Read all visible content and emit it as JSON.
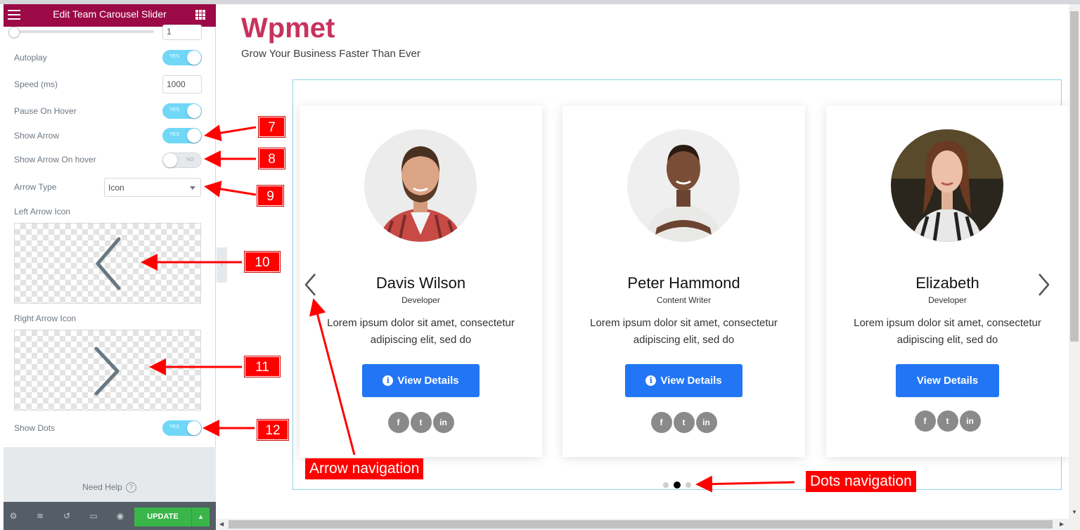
{
  "panel": {
    "title": "Edit Team Carousel Slider",
    "slides_value": "1",
    "controls": {
      "autoplay": {
        "label": "Autoplay",
        "state": "YES"
      },
      "speed": {
        "label": "Speed (ms)",
        "value": "1000"
      },
      "pause_on_hover": {
        "label": "Pause On Hover",
        "state": "YES"
      },
      "show_arrow": {
        "label": "Show Arrow",
        "state": "YES"
      },
      "show_arrow_on_hover": {
        "label": "Show Arrow On hover",
        "state": "NO"
      },
      "arrow_type": {
        "label": "Arrow Type",
        "value": "Icon"
      },
      "left_arrow_icon": {
        "label": "Left Arrow Icon",
        "icon": "chevron-left-icon"
      },
      "right_arrow_icon": {
        "label": "Right Arrow Icon",
        "icon": "chevron-right-icon"
      },
      "show_dots": {
        "label": "Show Dots",
        "state": "YES"
      }
    },
    "need_help": "Need Help",
    "help_icon": "?",
    "footer": {
      "update_label": "UPDATE"
    }
  },
  "preview": {
    "brand": "Wpmet",
    "tagline": "Grow Your Business Faster Than Ever",
    "cards": [
      {
        "name": "Davis Wilson",
        "role": "Developer",
        "bio": "Lorem ipsum dolor sit amet, consectetur adipiscing elit, sed do",
        "button": "View Details",
        "button_icon": "i",
        "socials": [
          "f",
          "t",
          "in"
        ]
      },
      {
        "name": "Peter Hammond",
        "role": "Content Writer",
        "bio": "Lorem ipsum dolor sit amet, consectetur adipiscing elit, sed do",
        "button": "View Details",
        "button_icon": "i",
        "socials": [
          "f",
          "t",
          "in"
        ]
      },
      {
        "name": "Elizabeth",
        "role": "Developer",
        "bio": "Lorem ipsum dolor sit amet, consectetur adipiscing elit, sed do",
        "button": "View Details",
        "socials": [
          "f",
          "t",
          "in"
        ]
      }
    ],
    "dots": {
      "count": 3,
      "active_index": 1
    }
  },
  "annotations": {
    "badges": [
      "7",
      "8",
      "9",
      "10",
      "11",
      "12"
    ],
    "arrow_navigation": "Arrow navigation",
    "dots_navigation": "Dots navigation"
  },
  "colors": {
    "panel_header": "#9b0a46",
    "brand": "#c8325f",
    "toggle_on": "#71d7f7",
    "button_blue": "#2275f5",
    "update_green": "#39b54a",
    "annotation_red": "#ff0000"
  }
}
